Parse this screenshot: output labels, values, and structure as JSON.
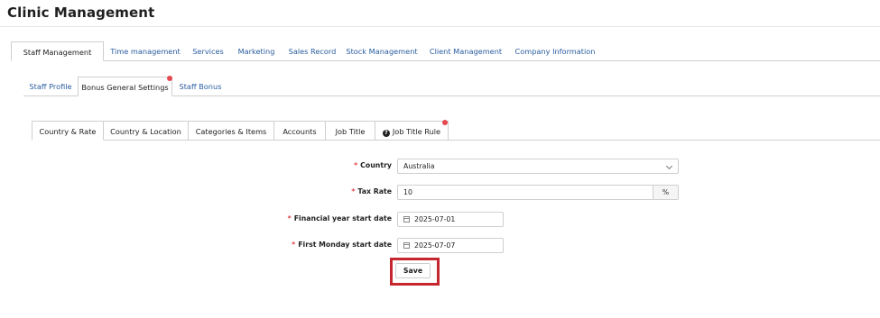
{
  "page_title": "Clinic Management",
  "main_tabs": [
    {
      "label": "Staff Management",
      "active": true
    },
    {
      "label": "Time management"
    },
    {
      "label": "Services"
    },
    {
      "label": "Marketing"
    },
    {
      "label": "Sales Record"
    },
    {
      "label": "Stock Management"
    },
    {
      "label": "Client Management"
    },
    {
      "label": "Company Information"
    }
  ],
  "sub_tabs": [
    {
      "label": "Staff Profile"
    },
    {
      "label": "Bonus General Settings",
      "active": true,
      "badge": true
    },
    {
      "label": "Staff Bonus"
    }
  ],
  "settings_tabs": [
    {
      "label": "Country & Rate",
      "active": true
    },
    {
      "label": "Country & Location"
    },
    {
      "label": "Categories & Items"
    },
    {
      "label": "Accounts"
    },
    {
      "label": "Job Title"
    },
    {
      "label": "Job Title Rule",
      "icon": "question-circle-icon",
      "badge": true
    }
  ],
  "form": {
    "country": {
      "label": "Country",
      "value": "Australia"
    },
    "tax_rate": {
      "label": "Tax Rate",
      "value": "10",
      "suffix": "%"
    },
    "financial_year_start": {
      "label": "Financial year start date",
      "value": "2025-07-01"
    },
    "first_monday_start": {
      "label": "First Monday start date",
      "value": "2025-07-07"
    },
    "required_mark": "*",
    "save_label": "Save"
  },
  "colors": {
    "link": "#2a5d9f",
    "required": "#e5484d",
    "badge": "#e5484d",
    "highlight_frame": "#c6262e"
  }
}
